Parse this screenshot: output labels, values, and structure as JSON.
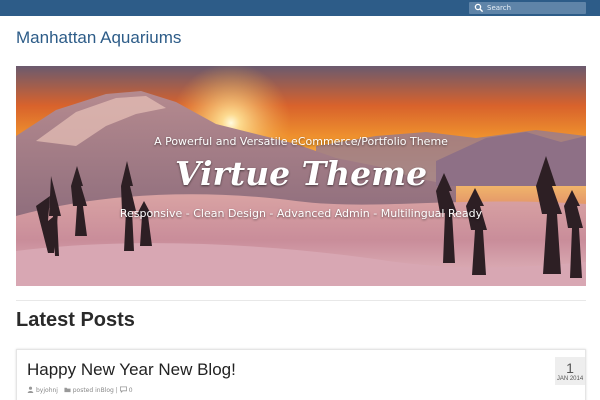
{
  "header": {
    "search_placeholder": "Search",
    "search_icon": "search-icon"
  },
  "site": {
    "title": "Manhattan Aquariums"
  },
  "slider": {
    "caption_top": "A Powerful and Versatile eCommerce/Portfolio Theme",
    "caption_title": "Virtue Theme",
    "caption_bottom": "Responsive - Clean Design - Advanced Admin - Multilingual Ready",
    "slides": 2,
    "active_slide": 1
  },
  "latest": {
    "heading": "Latest Posts",
    "post": {
      "title": "Happy New Year New Blog!",
      "author": "byjohnj",
      "posted_in": "posted in",
      "category": "Blog",
      "separator": "|",
      "comments": "0",
      "date_day": "1",
      "date_month_year": "JAN 2014"
    }
  },
  "colors": {
    "topbar": "#2d5c88",
    "search_bg": "#5f84a8",
    "site_title": "#2d5c88"
  }
}
